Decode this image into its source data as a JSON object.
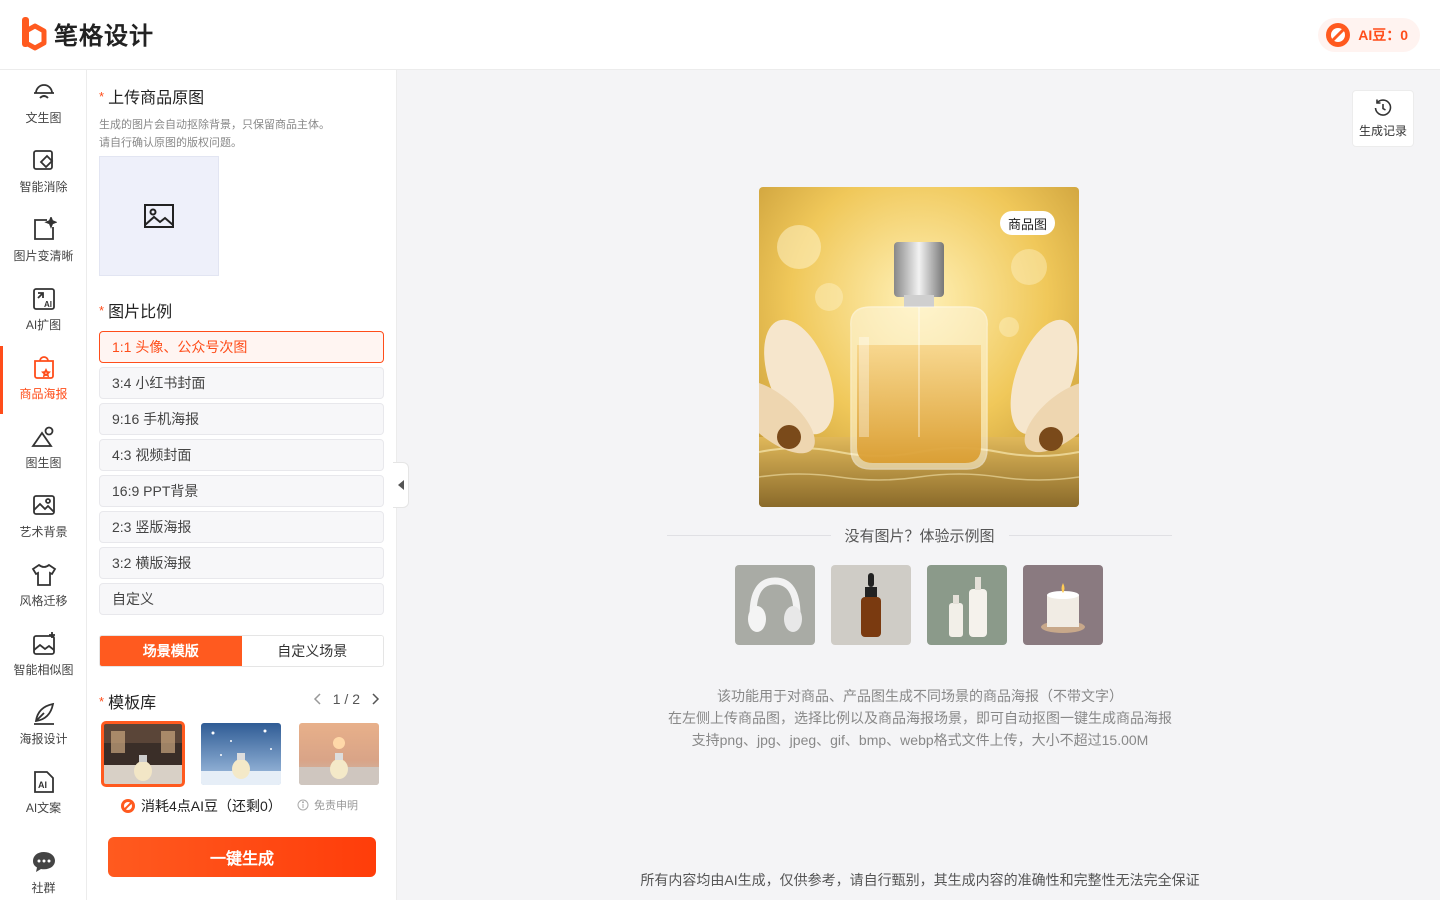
{
  "header": {
    "logo_text": "笔格设计",
    "ai_beans_label": "AI豆：0"
  },
  "nav": [
    {
      "label": "文生图",
      "icon": "text-to-image-icon"
    },
    {
      "label": "智能消除",
      "icon": "eraser-icon"
    },
    {
      "label": "图片变清晰",
      "icon": "sharpen-icon"
    },
    {
      "label": "AI扩图",
      "icon": "expand-icon"
    },
    {
      "label": "商品海报",
      "icon": "product-poster-icon",
      "active": true
    },
    {
      "label": "图生图",
      "icon": "image-to-image-icon"
    },
    {
      "label": "艺术背景",
      "icon": "art-background-icon"
    },
    {
      "label": "风格迁移",
      "icon": "style-transfer-icon"
    },
    {
      "label": "智能相似图",
      "icon": "similar-image-icon"
    },
    {
      "label": "海报设计",
      "icon": "poster-design-icon"
    },
    {
      "label": "AI文案",
      "icon": "ai-copywriting-icon"
    },
    {
      "label": "社群",
      "icon": "community-icon"
    }
  ],
  "panel": {
    "upload_title": "上传商品原图",
    "upload_hint_1": "生成的图片会自动抠除背景，只保留商品主体。",
    "upload_hint_2": "请自行确认原图的版权问题。",
    "ratio_title": "图片比例",
    "ratios": [
      "1:1 头像、公众号次图",
      "3:4 小红书封面",
      "9:16 手机海报",
      "4:3 视频封面",
      "16:9 PPT背景",
      "2:3 竖版海报",
      "3:2 横版海报",
      "自定义"
    ],
    "selected_ratio_index": 0,
    "tabs": [
      "场景模版",
      "自定义场景"
    ],
    "active_tab_index": 0,
    "template_title": "模板库",
    "pager": "1 / 2",
    "cost_text": "消耗4点AI豆（还剩0）",
    "disclaimer_text": "免责申明",
    "generate_label": "一键生成"
  },
  "main": {
    "history_label": "生成记录",
    "hero_tag": "商品图",
    "sample_title": "没有图片？体验示例图",
    "samples": [
      "headphones",
      "dropper-bottle",
      "cosmetic-bottles",
      "candle"
    ],
    "desc_lines": [
      "该功能用于对商品、产品图生成不同场景的商品海报（不带文字）",
      "在左侧上传商品图，选择比例以及商品海报场景，即可自动抠图一键生成商品海报",
      "支持png、jpg、jpeg、gif、bmp、webp格式文件上传，大小不超过15.00M"
    ],
    "footer_note": "所有内容均由AI生成，仅供参考，请自行甄别，其生成内容的准确性和完整性无法完全保证"
  },
  "colors": {
    "accent": "#ff4d1a",
    "panel_bg": "#ffffff",
    "page_bg": "#f4f4f6"
  }
}
